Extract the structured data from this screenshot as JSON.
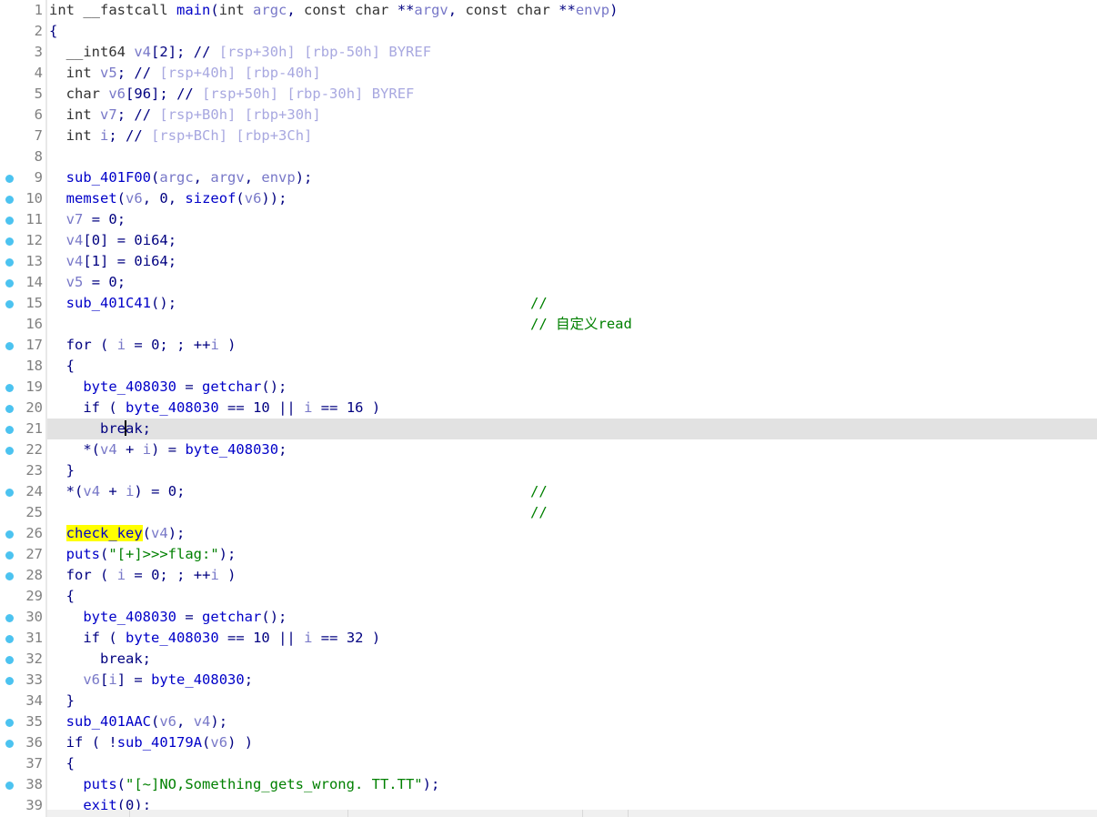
{
  "window": {
    "app": "IDA Pro Pseudocode View",
    "view_name": "Pseudocode-A"
  },
  "editor": {
    "current_line": 21,
    "caret_line": 21,
    "caret_column": 9,
    "highlight_word": "check_key",
    "highlight_color": "#ffff00",
    "current_line_color": "#e2e2e2",
    "breakpoint_dot_color": "#4cc3f0",
    "comment_color": "#008000",
    "code_color": "#000080",
    "variable_color": "#7878c8",
    "stack_offset_color": "#a8a8e0",
    "gutter_number_color": "#808080",
    "background_color": "#ffffff"
  },
  "lines": [
    {
      "n": 1,
      "dot": false,
      "text": "int __fastcall main(int argc, const char **argv, const char **envp)"
    },
    {
      "n": 2,
      "dot": false,
      "text": "{"
    },
    {
      "n": 3,
      "dot": false,
      "text": "  __int64 v4[2]; // [rsp+30h] [rbp-50h] BYREF"
    },
    {
      "n": 4,
      "dot": false,
      "text": "  int v5; // [rsp+40h] [rbp-40h]"
    },
    {
      "n": 5,
      "dot": false,
      "text": "  char v6[96]; // [rsp+50h] [rbp-30h] BYREF"
    },
    {
      "n": 6,
      "dot": false,
      "text": "  int v7; // [rsp+B0h] [rbp+30h]"
    },
    {
      "n": 7,
      "dot": false,
      "text": "  int i; // [rsp+BCh] [rbp+3Ch]"
    },
    {
      "n": 8,
      "dot": false,
      "text": ""
    },
    {
      "n": 9,
      "dot": true,
      "text": "  sub_401F00(argc, argv, envp);"
    },
    {
      "n": 10,
      "dot": true,
      "text": "  memset(v6, 0, sizeof(v6));"
    },
    {
      "n": 11,
      "dot": true,
      "text": "  v7 = 0;"
    },
    {
      "n": 12,
      "dot": true,
      "text": "  v4[0] = 0i64;"
    },
    {
      "n": 13,
      "dot": true,
      "text": "  v4[1] = 0i64;"
    },
    {
      "n": 14,
      "dot": true,
      "text": "  v5 = 0;"
    },
    {
      "n": 15,
      "dot": true,
      "text": "  sub_401C41();",
      "comment": "//"
    },
    {
      "n": 16,
      "dot": false,
      "text": "",
      "comment": "// 自定义read"
    },
    {
      "n": 17,
      "dot": true,
      "text": "  for ( i = 0; ; ++i )"
    },
    {
      "n": 18,
      "dot": false,
      "text": "  {"
    },
    {
      "n": 19,
      "dot": true,
      "text": "    byte_408030 = getchar();"
    },
    {
      "n": 20,
      "dot": true,
      "text": "    if ( byte_408030 == 10 || i == 16 )"
    },
    {
      "n": 21,
      "dot": true,
      "text": "      break;",
      "current": true
    },
    {
      "n": 22,
      "dot": true,
      "text": "    *(v4 + i) = byte_408030;"
    },
    {
      "n": 23,
      "dot": false,
      "text": "  }"
    },
    {
      "n": 24,
      "dot": true,
      "text": "  *(v4 + i) = 0;",
      "comment": "//"
    },
    {
      "n": 25,
      "dot": false,
      "text": "",
      "comment": "//"
    },
    {
      "n": 26,
      "dot": true,
      "text": "  check_key(v4);"
    },
    {
      "n": 27,
      "dot": true,
      "text": "  puts(\"[+]>>>flag:\");"
    },
    {
      "n": 28,
      "dot": true,
      "text": "  for ( i = 0; ; ++i )"
    },
    {
      "n": 29,
      "dot": false,
      "text": "  {"
    },
    {
      "n": 30,
      "dot": true,
      "text": "    byte_408030 = getchar();"
    },
    {
      "n": 31,
      "dot": true,
      "text": "    if ( byte_408030 == 10 || i == 32 )"
    },
    {
      "n": 32,
      "dot": true,
      "text": "      break;"
    },
    {
      "n": 33,
      "dot": true,
      "text": "    v6[i] = byte_408030;"
    },
    {
      "n": 34,
      "dot": false,
      "text": "  }"
    },
    {
      "n": 35,
      "dot": true,
      "text": "  sub_401AAC(v6, v4);"
    },
    {
      "n": 36,
      "dot": true,
      "text": "  if ( !sub_40179A(v6) )"
    },
    {
      "n": 37,
      "dot": false,
      "text": "  {"
    },
    {
      "n": 38,
      "dot": true,
      "text": "    puts(\"[~]NO,Something_gets_wrong. TT.TT\");"
    },
    {
      "n": 39,
      "dot": false,
      "text": "    exit(0);"
    }
  ]
}
